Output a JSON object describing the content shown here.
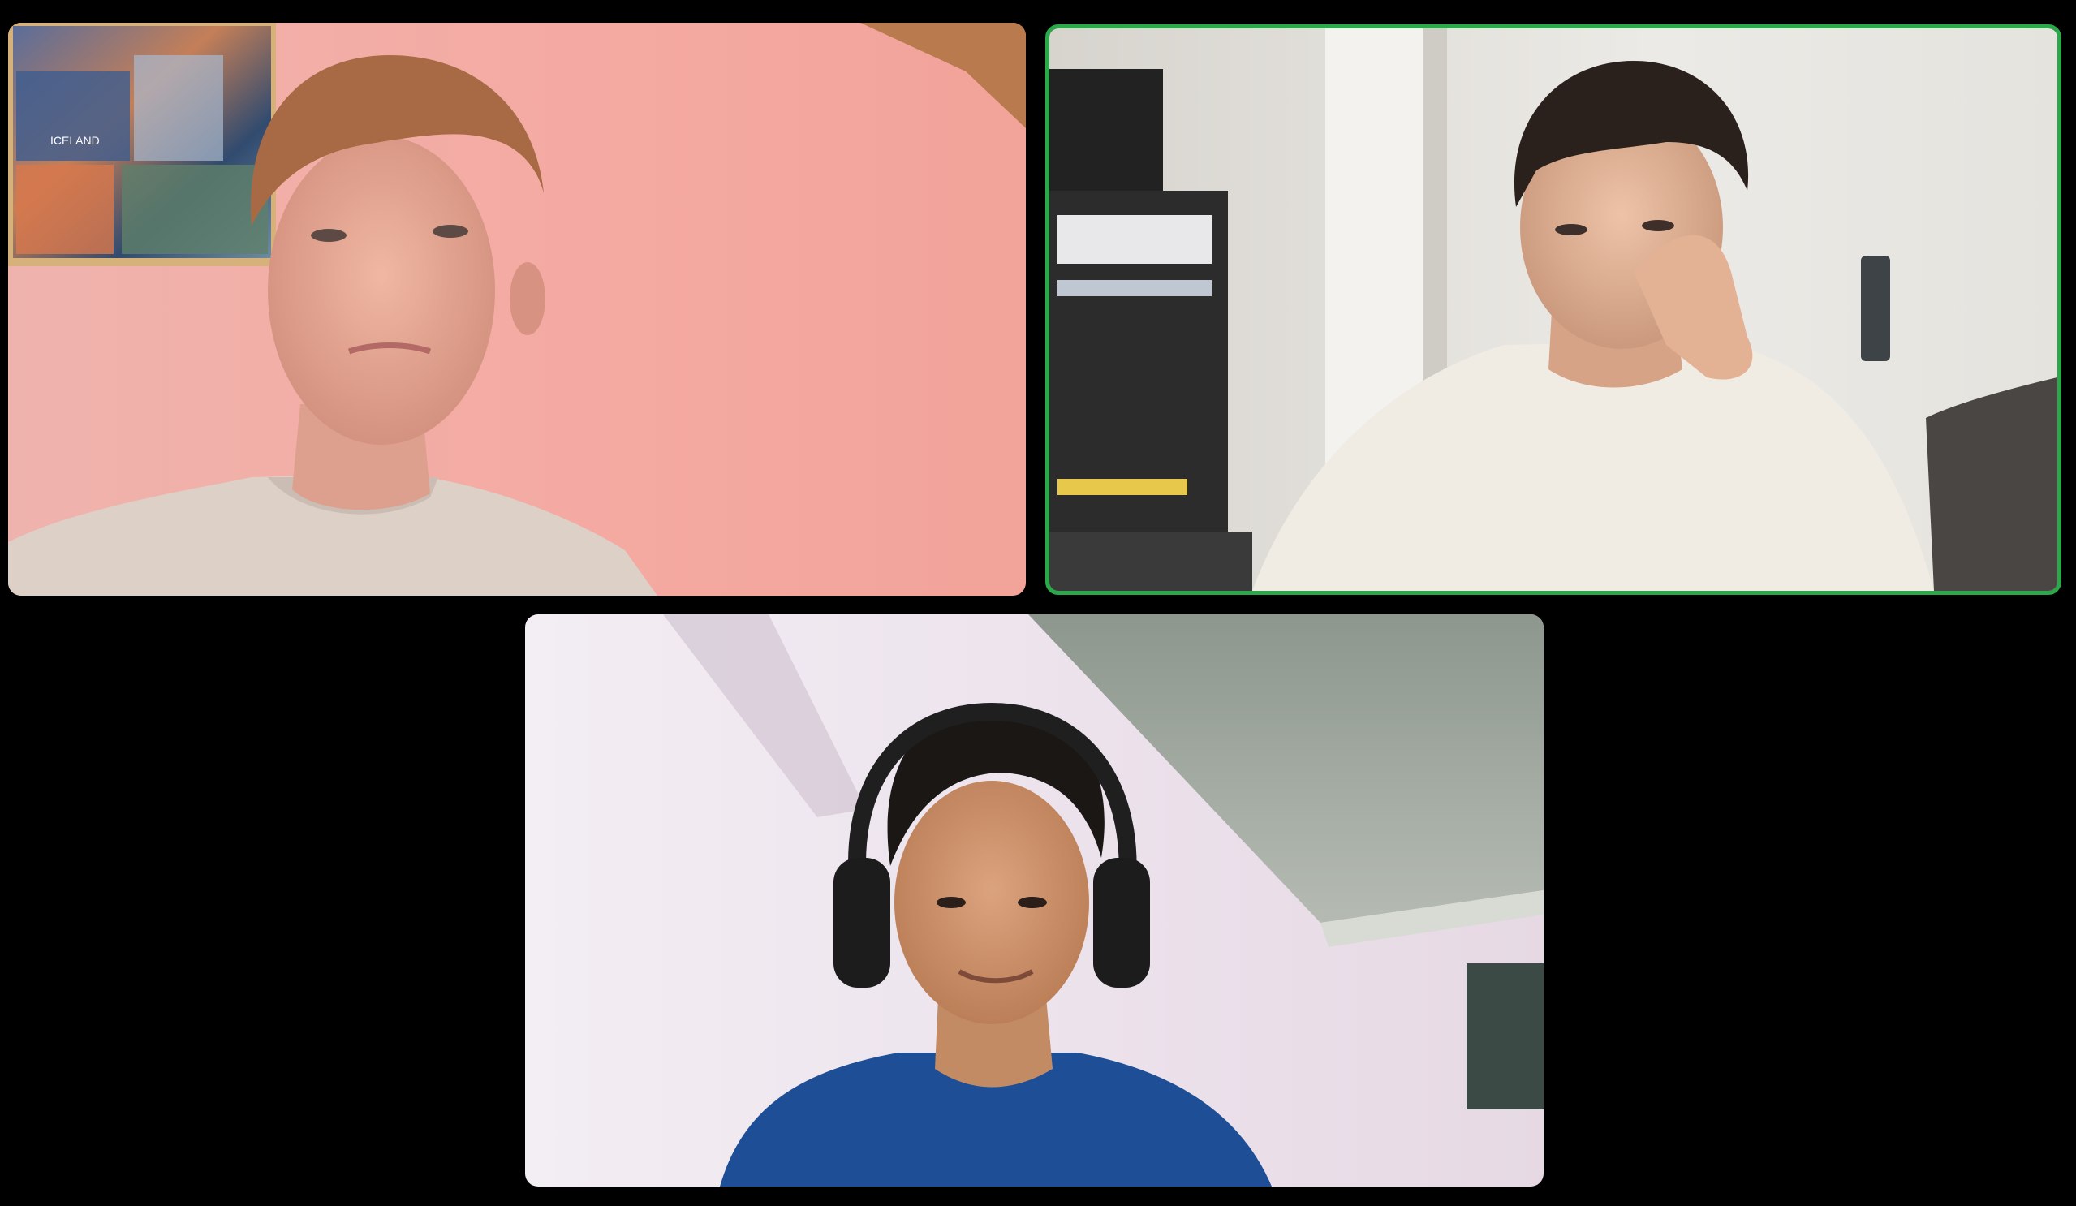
{
  "meeting": {
    "layout": "gallery",
    "participant_count": 3,
    "active_speaker_color": "#2aa84a"
  },
  "participants": [
    {
      "id": "p1",
      "active_speaker": false,
      "scene": {
        "wall": "#f1aaa3",
        "poster_text": "ICELAND"
      }
    },
    {
      "id": "p2",
      "active_speaker": true,
      "scene": {
        "wall": "#e9e7e2"
      }
    },
    {
      "id": "p3",
      "active_speaker": false,
      "scene": {
        "wall": "#ede4ef"
      }
    }
  ]
}
